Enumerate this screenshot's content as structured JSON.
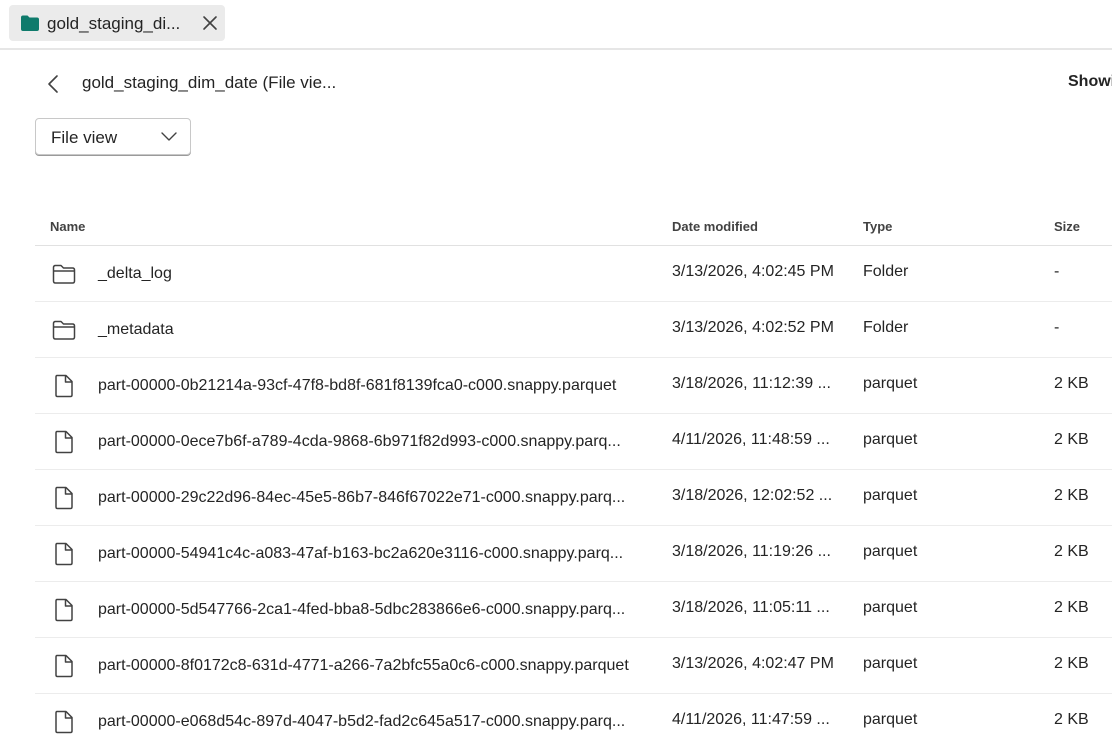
{
  "tab": {
    "label": "gold_staging_di...",
    "icon": "folder-icon",
    "icon_color": "#0f7b6c"
  },
  "header": {
    "title": "gold_staging_dim_date (File vie...",
    "showing": "Showi"
  },
  "view_dropdown": {
    "value": "File view"
  },
  "table": {
    "columns": {
      "name": "Name",
      "date": "Date modified",
      "type": "Type",
      "size": "Size"
    },
    "rows": [
      {
        "icon": "folder-icon",
        "name": "_delta_log",
        "date": "3/13/2026, 4:02:45 PM",
        "type": "Folder",
        "size": "-"
      },
      {
        "icon": "folder-icon",
        "name": "_metadata",
        "date": "3/13/2026, 4:02:52 PM",
        "type": "Folder",
        "size": "-"
      },
      {
        "icon": "file-icon",
        "name": "part-00000-0b21214a-93cf-47f8-bd8f-681f8139fca0-c000.snappy.parquet",
        "date": "3/18/2026, 11:12:39 ...",
        "type": "parquet",
        "size": "2 KB"
      },
      {
        "icon": "file-icon",
        "name": "part-00000-0ece7b6f-a789-4cda-9868-6b971f82d993-c000.snappy.parq...",
        "date": "4/11/2026, 11:48:59 ...",
        "type": "parquet",
        "size": "2 KB"
      },
      {
        "icon": "file-icon",
        "name": "part-00000-29c22d96-84ec-45e5-86b7-846f67022e71-c000.snappy.parq...",
        "date": "3/18/2026, 12:02:52 ...",
        "type": "parquet",
        "size": "2 KB"
      },
      {
        "icon": "file-icon",
        "name": "part-00000-54941c4c-a083-47af-b163-bc2a620e3116-c000.snappy.parq...",
        "date": "3/18/2026, 11:19:26 ...",
        "type": "parquet",
        "size": "2 KB"
      },
      {
        "icon": "file-icon",
        "name": "part-00000-5d547766-2ca1-4fed-bba8-5dbc283866e6-c000.snappy.parq...",
        "date": "3/18/2026, 11:05:11 ...",
        "type": "parquet",
        "size": "2 KB"
      },
      {
        "icon": "file-icon",
        "name": "part-00000-8f0172c8-631d-4771-a266-7a2bfc55a0c6-c000.snappy.parquet",
        "date": "3/13/2026, 4:02:47 PM",
        "type": "parquet",
        "size": "2 KB"
      },
      {
        "icon": "file-icon",
        "name": "part-00000-e068d54c-897d-4047-b5d2-fad2c645a517-c000.snappy.parq...",
        "date": "4/11/2026, 11:47:59 ...",
        "type": "parquet",
        "size": "2 KB"
      }
    ]
  }
}
